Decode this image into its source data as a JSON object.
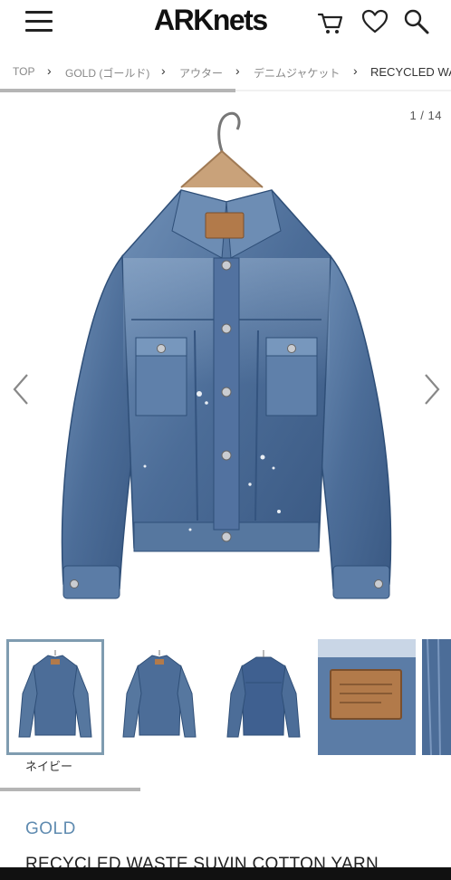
{
  "header": {
    "logo": "ARKnets",
    "icons": [
      "menu-icon",
      "cart-icon",
      "heart-icon",
      "search-icon"
    ]
  },
  "breadcrumb": {
    "items": [
      "TOP",
      "GOLD (ゴールド)",
      "アウター",
      "デニムジャケット",
      "RECYCLED WA"
    ]
  },
  "gallery": {
    "counter": "1 / 14",
    "color_label": "ネイビー"
  },
  "product": {
    "brand": "GOLD",
    "name": "RECYCLED WASTE SUVIN COTTON YARN"
  },
  "colors": {
    "brand_text": "#5f8bb0",
    "selected_outline": "#7f9cb0",
    "denim_dark": "#2f4f78",
    "denim_mid": "#4c6d98",
    "denim_light": "#8aa7c9",
    "leather_patch": "#b27a4a"
  }
}
